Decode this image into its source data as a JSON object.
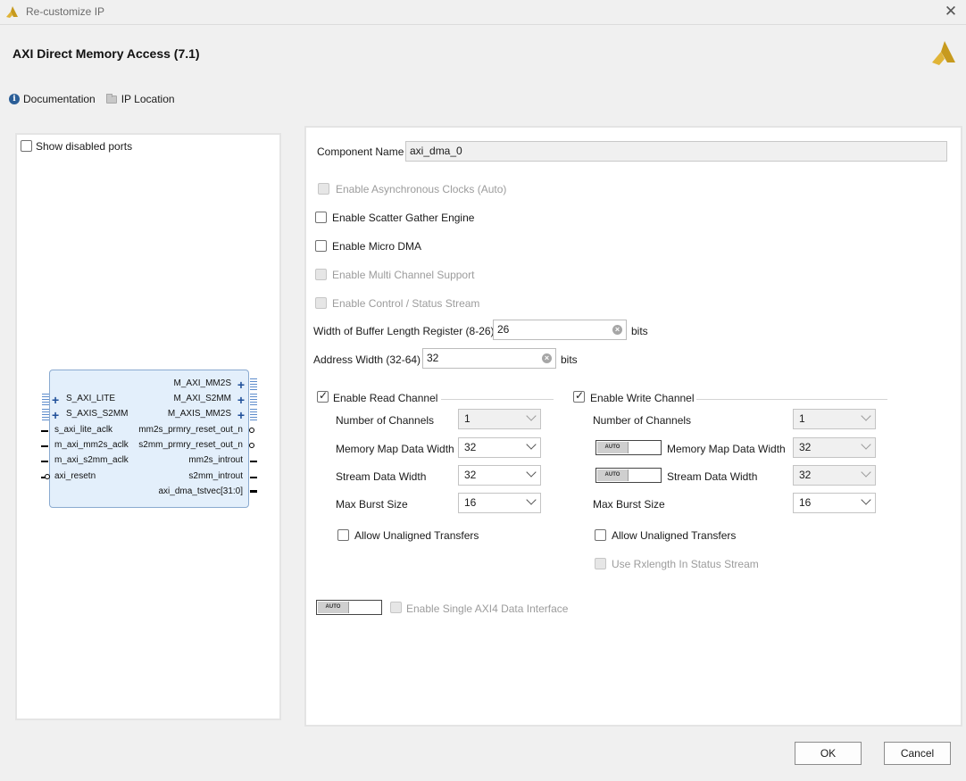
{
  "window": {
    "title": "Re-customize IP",
    "close_label": "✕"
  },
  "header": {
    "title": "AXI Direct Memory Access (7.1)"
  },
  "links": {
    "documentation": "Documentation",
    "ip_location": "IP Location"
  },
  "left": {
    "show_disabled_ports": "Show disabled ports",
    "block_ports": {
      "left": [
        "S_AXI_LITE",
        "S_AXIS_S2MM",
        "s_axi_lite_aclk",
        "m_axi_mm2s_aclk",
        "m_axi_s2mm_aclk",
        "axi_resetn"
      ],
      "right": [
        "M_AXI_MM2S",
        "M_AXI_S2MM",
        "M_AXIS_MM2S",
        "mm2s_prmry_reset_out_n",
        "s2mm_prmry_reset_out_n",
        "mm2s_introut",
        "s2mm_introut",
        "axi_dma_tstvec[31:0]"
      ]
    }
  },
  "config": {
    "component_name_label": "Component Name",
    "component_name_value": "axi_dma_0",
    "async_clocks": "Enable Asynchronous Clocks (Auto)",
    "scatter_gather": "Enable Scatter Gather Engine",
    "micro_dma": "Enable Micro DMA",
    "multi_channel": "Enable Multi Channel Support",
    "control_status": "Enable Control / Status Stream",
    "buffer_length_label": "Width of Buffer Length Register (8-26)",
    "buffer_length_value": "26",
    "bits": "bits",
    "address_width_label": "Address Width (32-64)",
    "address_width_value": "32",
    "auto_label": "AUTO",
    "single_axi4": "Enable Single AXI4 Data Interface"
  },
  "read_channel": {
    "title": "Enable Read Channel",
    "num_channels_label": "Number of Channels",
    "num_channels": "1",
    "mm_width_label": "Memory Map Data Width",
    "mm_width": "32",
    "stream_width_label": "Stream Data Width",
    "stream_width": "32",
    "burst_label": "Max Burst Size",
    "burst": "16",
    "unaligned": "Allow Unaligned Transfers"
  },
  "write_channel": {
    "title": "Enable Write Channel",
    "num_channels_label": "Number of Channels",
    "num_channels": "1",
    "mm_width_label": "Memory Map Data Width",
    "mm_width": "32",
    "stream_width_label": "Stream Data Width",
    "stream_width": "32",
    "burst_label": "Max Burst Size",
    "burst": "16",
    "unaligned": "Allow Unaligned Transfers",
    "rxlength": "Use Rxlength In Status Stream"
  },
  "buttons": {
    "ok": "OK",
    "cancel": "Cancel"
  },
  "colors": {
    "logo": "#c79a1e",
    "accent": "#2b5e97",
    "block_fill": "#e3effb"
  }
}
